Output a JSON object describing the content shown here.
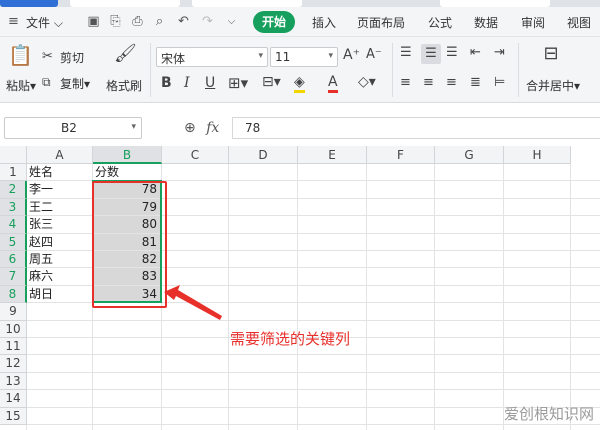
{
  "menu": {
    "file_label": "文件",
    "tabs": [
      {
        "label": "开始",
        "active": true
      },
      {
        "label": "插入"
      },
      {
        "label": "页面布局"
      },
      {
        "label": "公式"
      },
      {
        "label": "数据"
      },
      {
        "label": "审阅"
      },
      {
        "label": "视图"
      }
    ]
  },
  "ribbon": {
    "paste_label": "粘贴",
    "cut_label": "剪切",
    "copy_label": "复制",
    "format_painter_label": "格式刷",
    "font_name": "宋体",
    "font_size": "11",
    "merge_label": "合并居中"
  },
  "formula_bar": {
    "cell_ref": "B2",
    "fx_label": "fx",
    "value": "78"
  },
  "sheet": {
    "columns": [
      "A",
      "B",
      "C",
      "D",
      "E",
      "F",
      "G",
      "H"
    ],
    "rows": [
      "1",
      "2",
      "3",
      "4",
      "5",
      "6",
      "7",
      "8",
      "9",
      "10",
      "11",
      "12",
      "13",
      "14",
      "15"
    ],
    "header": {
      "name": "姓名",
      "score": "分数"
    },
    "records": [
      {
        "name": "李一",
        "score": "78"
      },
      {
        "name": "王二",
        "score": "79"
      },
      {
        "name": "张三",
        "score": "80"
      },
      {
        "name": "赵四",
        "score": "81"
      },
      {
        "name": "周五",
        "score": "82"
      },
      {
        "name": "麻六",
        "score": "83"
      },
      {
        "name": "胡日",
        "score": "34"
      }
    ]
  },
  "annotation": {
    "text": "需要筛选的关键列"
  },
  "watermark": {
    "text": "爱创根知识网"
  },
  "colors": {
    "accent": "#17a05d",
    "annotation": "#e8302b",
    "selection": "#d8d8d8"
  }
}
